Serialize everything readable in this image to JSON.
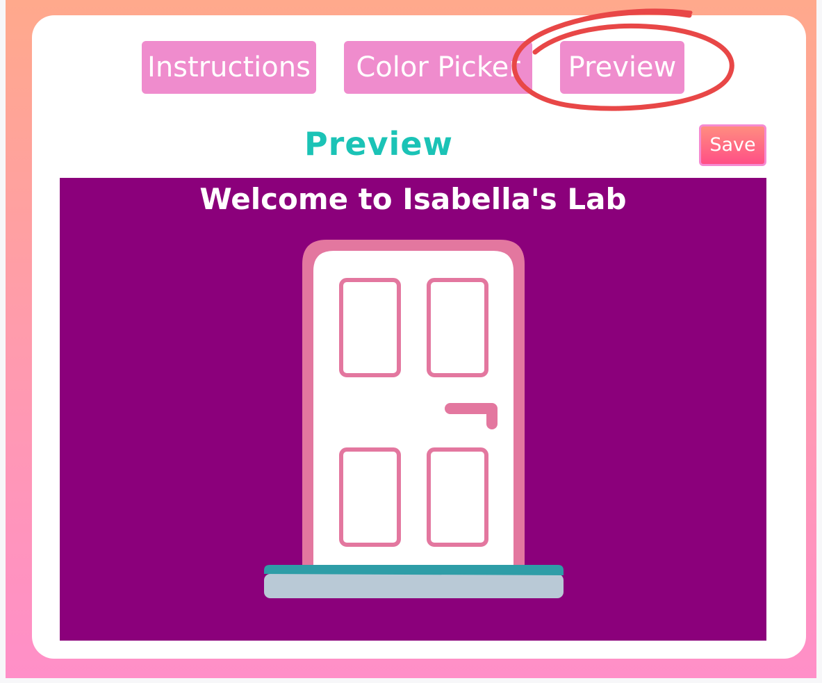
{
  "tabs": {
    "instructions": "Instructions",
    "color_picker": "Color Picker",
    "preview": "Preview"
  },
  "section": {
    "title": "Preview",
    "save_label": "Save"
  },
  "preview_content": {
    "welcome_text": "Welcome to Isabella's Lab",
    "background_color": "#8b007b",
    "door_frame_color": "#e3779f",
    "door_color": "#ffffff",
    "step_top_color": "#2e9da7",
    "step_bottom_color": "#b9c9d6"
  },
  "colors": {
    "tab_bg": "#ef8ccd",
    "title_color": "#1bc3b6",
    "highlight_circle": "#e84747"
  },
  "icons": {
    "door": "door-icon"
  }
}
